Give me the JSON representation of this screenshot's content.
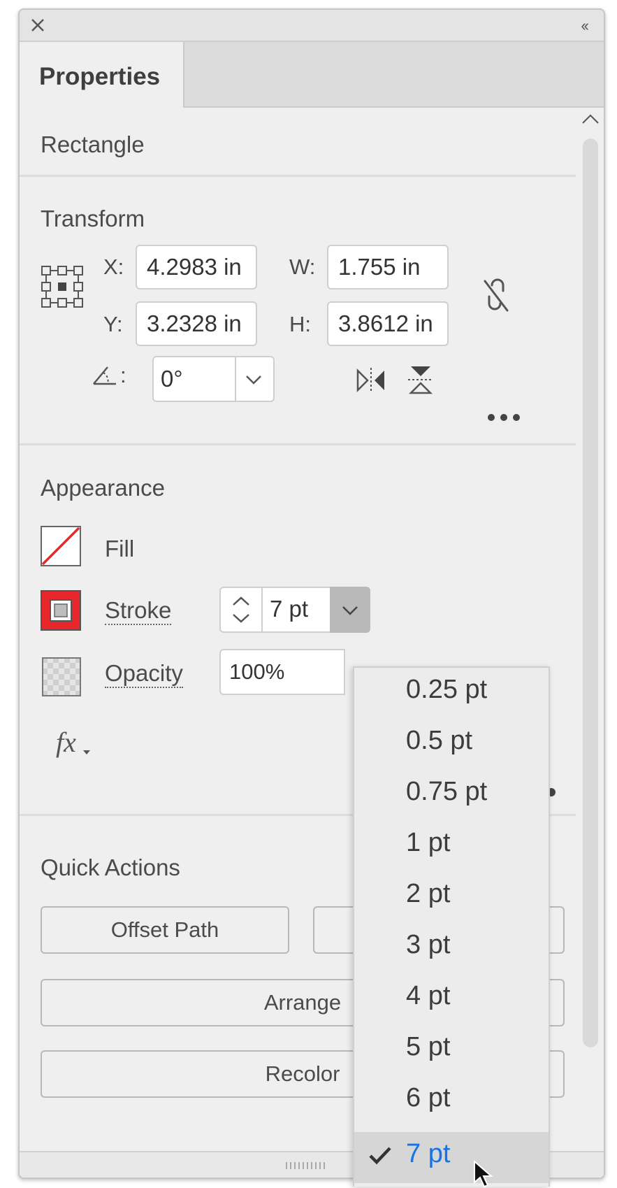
{
  "panel": {
    "tab_label": "Properties",
    "collapse_glyph": "‹‹"
  },
  "object_type": "Rectangle",
  "transform": {
    "title": "Transform",
    "x_label": "X:",
    "x_value": "4.2983 in",
    "y_label": "Y:",
    "y_value": "3.2328 in",
    "w_label": "W:",
    "w_value": "1.755 in",
    "h_label": "H:",
    "h_value": "3.8612 in",
    "angle_label": ":",
    "angle_value": "0°"
  },
  "appearance": {
    "title": "Appearance",
    "fill_label": "Fill",
    "stroke_label": "Stroke",
    "stroke_value": "7 pt",
    "opacity_label": "Opacity",
    "opacity_value": "100%",
    "fx_label": "fx"
  },
  "quick_actions": {
    "title": "Quick Actions",
    "offset_path": "Offset Path",
    "arrange": "Arrange",
    "recolor": "Recolor"
  },
  "stroke_dropdown": {
    "items": [
      "0.25 pt",
      "0.5 pt",
      "0.75 pt",
      "1 pt",
      "2 pt",
      "3 pt",
      "4 pt",
      "5 pt",
      "6 pt",
      "7 pt"
    ],
    "selected": "7 pt"
  },
  "colors": {
    "accent": "#1473e6",
    "stroke_swatch": "#e8262c",
    "fill_none_line": "#e8262c"
  }
}
